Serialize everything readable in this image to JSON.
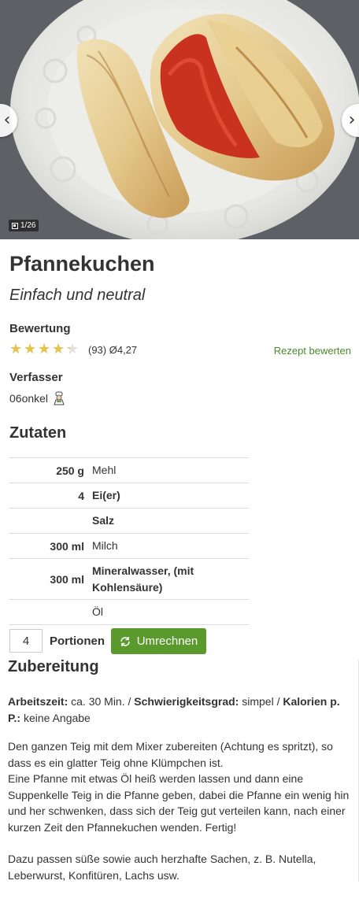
{
  "gallery": {
    "counter": "1/26",
    "prev_icon": "chevron-left-icon",
    "next_icon": "chevron-right-icon"
  },
  "recipe": {
    "title": "Pfannekuchen",
    "subtitle": "Einfach und neutral"
  },
  "rating": {
    "label": "Bewertung",
    "value": 4.27,
    "max": 5,
    "count_text": "(93) Ø4,27",
    "rate_link": "Rezept bewerten",
    "star_color": "#e7c34a"
  },
  "author": {
    "label": "Verfasser",
    "name": "06onkel"
  },
  "ingredients": {
    "heading": "Zutaten",
    "rows": [
      {
        "amount": "250 g",
        "name": "Mehl",
        "bold": false
      },
      {
        "amount": "4",
        "name": "Ei(er)",
        "bold": true
      },
      {
        "amount": "",
        "name": "Salz",
        "bold": true
      },
      {
        "amount": "300 ml",
        "name": "Milch",
        "bold": false
      },
      {
        "amount": "300 ml",
        "name": "Mineralwasser, (mit Kohlensäure)",
        "bold": true
      },
      {
        "amount": "",
        "name": "Öl",
        "bold": false
      }
    ]
  },
  "portions": {
    "value": "4",
    "label": "Portionen",
    "button": "Umrechnen",
    "button_color": "#5a9a2c"
  },
  "preparation": {
    "heading": "Zubereitung",
    "worktime_label": "Arbeitszeit:",
    "worktime_value": " ca. 30 Min. / ",
    "difficulty_label": "Schwierigkeitsgrad:",
    "difficulty_value": " simpel / ",
    "calories_label": "Kalorien p. P.:",
    "calories_value": " keine Angabe",
    "paragraph1": "Den ganzen Teig mit dem Mixer zubereiten (Achtung es spritzt), so dass es ein glatter Teig ohne Klümpchen ist.\nEine Pfanne mit etwas Öl heiß werden lassen und dann eine Suppenkelle Teig in die Pfanne geben, dabei die Pfanne ein wenig hin und her schwenken, dass sich der Teig gut verteilen kann, nach einer kurzen Zeit den Pfannekuchen wenden. Fertig!",
    "paragraph2": "Dazu passen süße sowie auch herzhafte Sachen, z. B. Nutella, Leberwurst, Konfitüren, Lachs usw."
  }
}
